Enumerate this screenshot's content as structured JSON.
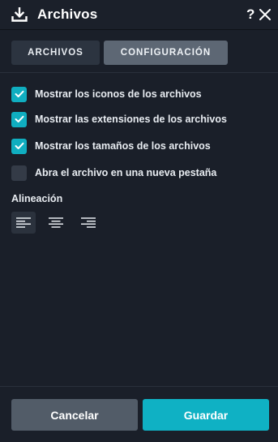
{
  "header": {
    "title": "Archivos",
    "help_label": "?",
    "icons": {
      "title_icon": "download-icon",
      "close_icon": "close-icon"
    }
  },
  "tabs": [
    {
      "label": "ARCHIVOS",
      "active": false
    },
    {
      "label": "CONFIGURACIÓN",
      "active": true
    }
  ],
  "options": [
    {
      "label": "Mostrar los iconos de los archivos",
      "checked": true
    },
    {
      "label": "Mostrar las extensiones de los archivos",
      "checked": true
    },
    {
      "label": "Mostrar los tamaños de los archivos",
      "checked": true
    },
    {
      "label": "Abra el archivo en una nueva pestaña",
      "checked": false
    }
  ],
  "alignment": {
    "title": "Alineación",
    "options": [
      {
        "icon": "align-left-icon",
        "active": true
      },
      {
        "icon": "align-center-icon",
        "active": false
      },
      {
        "icon": "align-right-icon",
        "active": false
      }
    ]
  },
  "footer": {
    "cancel_label": "Cancelar",
    "save_label": "Guardar"
  },
  "colors": {
    "background": "#1a1f29",
    "accent": "#10aec0",
    "checkbox_unchecked": "#343b47",
    "active_tab": "#5d6774",
    "inactive_tab": "#2c3440",
    "cancel_button": "#525c68"
  }
}
